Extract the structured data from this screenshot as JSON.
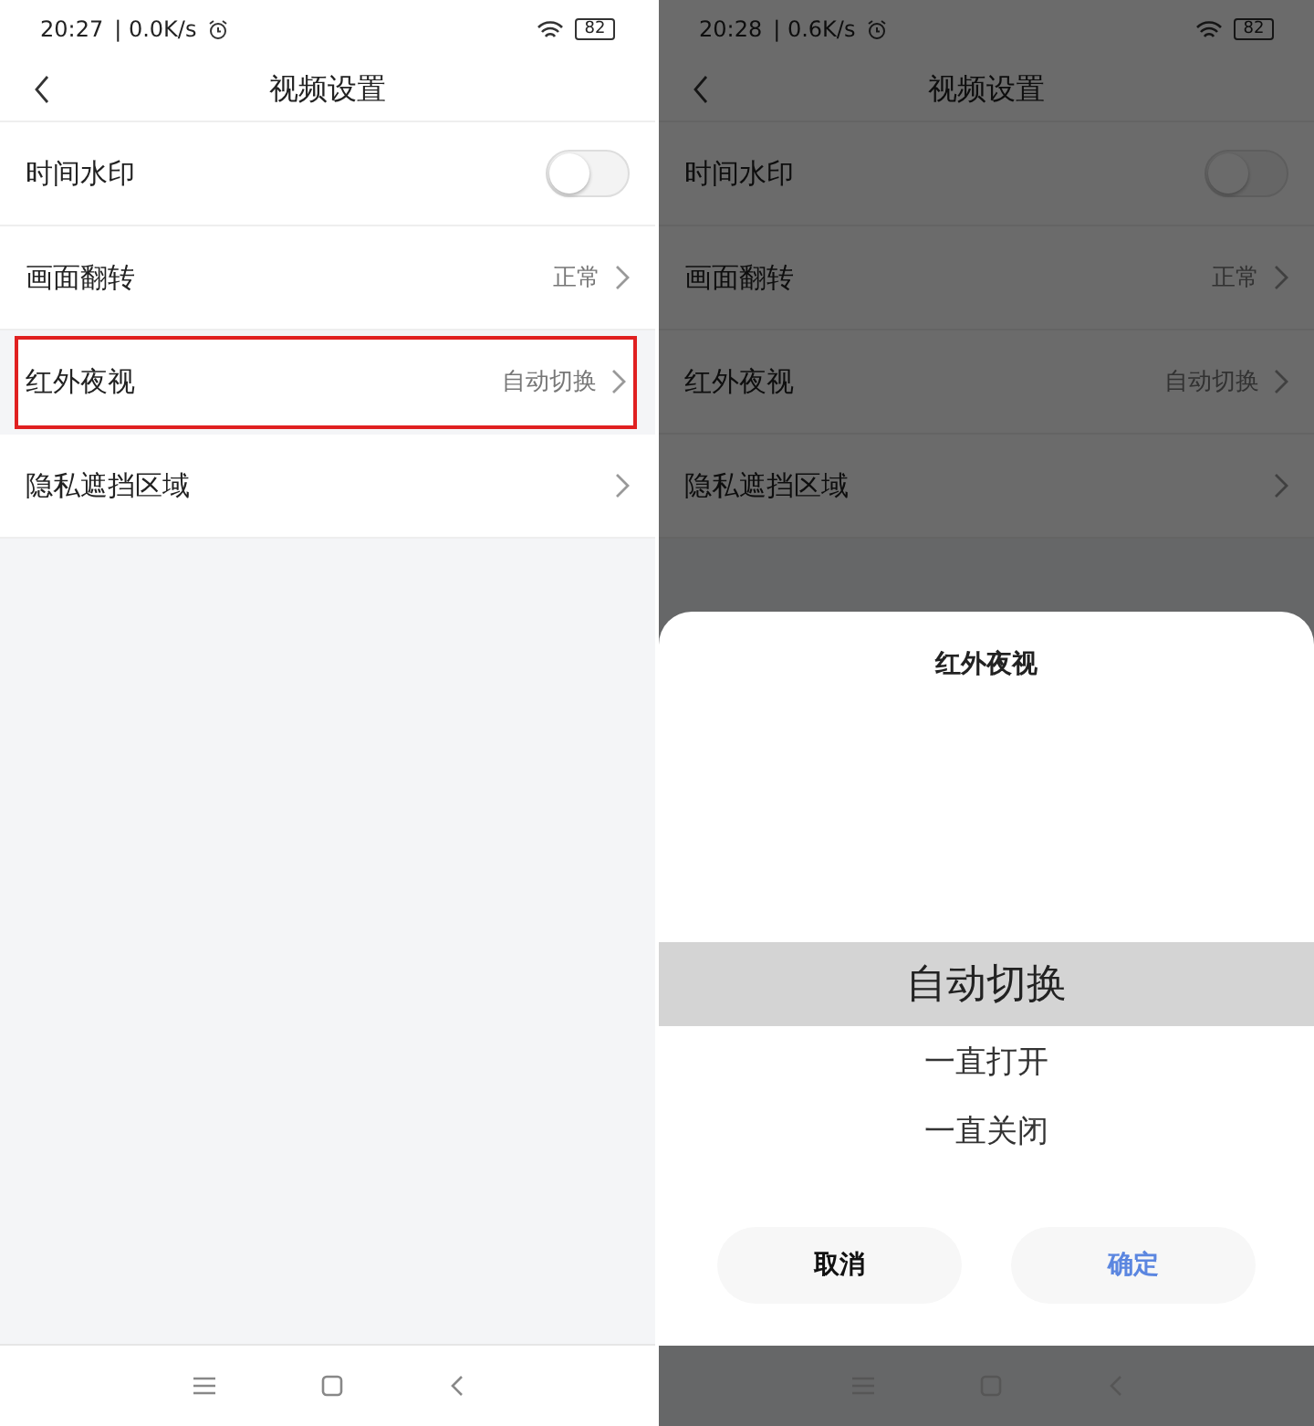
{
  "screens": [
    {
      "status_bar": {
        "time": "20:27",
        "speed": "| 0.0K/s",
        "battery": "82"
      },
      "header": {
        "title": "视频设置"
      },
      "rows": [
        {
          "kind": "toggle",
          "label": "时间水印",
          "on": false,
          "highlighted": false
        },
        {
          "kind": "link",
          "label": "画面翻转",
          "value": "正常",
          "highlighted": false
        },
        {
          "kind": "link",
          "label": "红外夜视",
          "value": "自动切换",
          "highlighted": true
        },
        {
          "kind": "link",
          "label": "隐私遮挡区域",
          "highlighted": false
        }
      ]
    },
    {
      "status_bar": {
        "time": "20:28",
        "speed": "| 0.6K/s",
        "battery": "82"
      },
      "header": {
        "title": "视频设置"
      },
      "rows": [
        {
          "kind": "toggle",
          "label": "时间水印",
          "on": false,
          "highlighted": false
        },
        {
          "kind": "link",
          "label": "画面翻转",
          "value": "正常",
          "highlighted": false
        },
        {
          "kind": "link",
          "label": "红外夜视",
          "value": "自动切换",
          "highlighted": false
        },
        {
          "kind": "link",
          "label": "隐私遮挡区域",
          "highlighted": false
        }
      ],
      "sheet": {
        "title": "红外夜视",
        "options": [
          {
            "label": "自动切换",
            "selected": true
          },
          {
            "label": "一直打开",
            "selected": false
          },
          {
            "label": "一直关闭",
            "selected": false
          }
        ],
        "buttons": [
          {
            "label": "取消",
            "kind": "cancel"
          },
          {
            "label": "确定",
            "kind": "confirm"
          }
        ]
      }
    }
  ]
}
